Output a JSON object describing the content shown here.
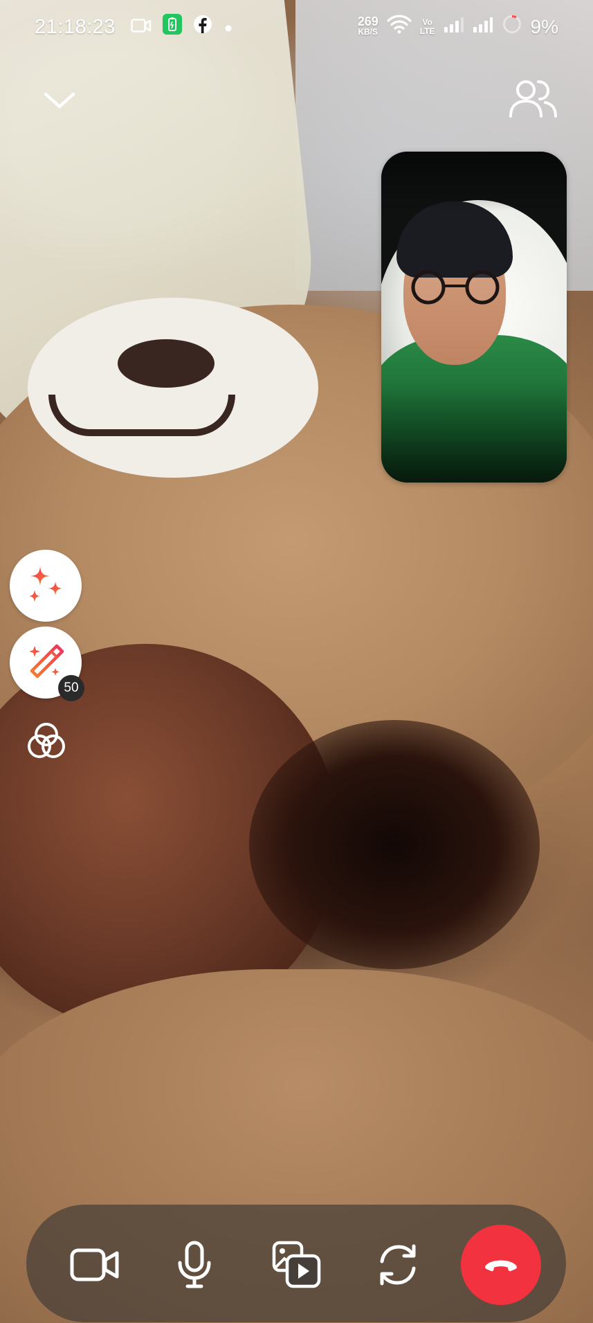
{
  "status_bar": {
    "time": "21:18:23",
    "net_speed_value": "269",
    "net_speed_unit": "KB/S",
    "volte_line1": "Vo",
    "volte_line2": "LTE",
    "battery": "9%",
    "icons": [
      "video-camera-icon",
      "battery-saver-icon",
      "facebook-icon",
      "dot-icon",
      "wifi-icon",
      "signal-icon",
      "signal-icon",
      "battery-ring-icon"
    ]
  },
  "top_controls": {
    "collapse_icon": "chevron-down-icon",
    "participants_icon": "people-icon"
  },
  "effects": {
    "sparkle_icon": "sparkle-icon",
    "wand_icon": "magic-wand-icon",
    "wand_badge": "50",
    "filter_icon": "filter-circles-icon"
  },
  "controls": {
    "items": [
      "video-camera-icon",
      "microphone-icon",
      "share-media-icon",
      "flip-camera-icon",
      "end-call-icon"
    ],
    "end_call_color": "#F2323F"
  },
  "colors": {
    "accent_gradient": [
      "#F2325A",
      "#F57E2A"
    ],
    "bar_background": "rgba(70,62,56,0.72)"
  }
}
